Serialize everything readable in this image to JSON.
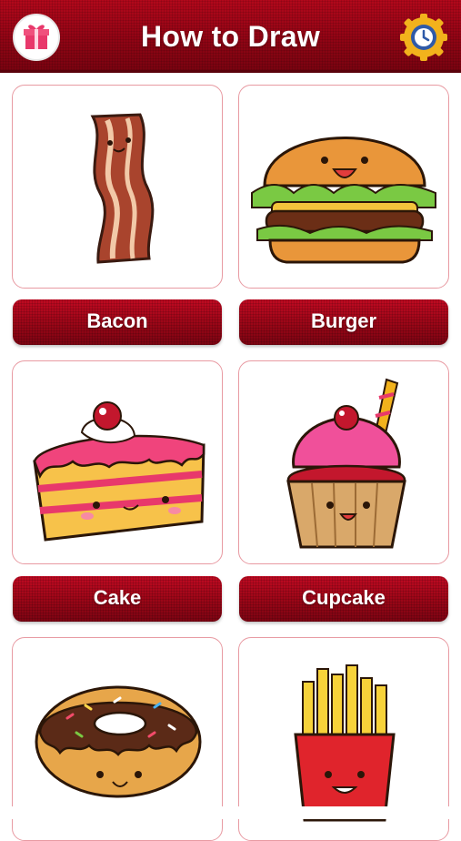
{
  "header": {
    "title": "How to Draw",
    "left_icon": "gift-icon",
    "right_icon": "settings-clock-icon"
  },
  "items": [
    {
      "label": "Bacon",
      "icon": "bacon-icon"
    },
    {
      "label": "Burger",
      "icon": "burger-icon"
    },
    {
      "label": "Cake",
      "icon": "cake-icon"
    },
    {
      "label": "Cupcake",
      "icon": "cupcake-icon"
    },
    {
      "icon": "donut-icon"
    },
    {
      "icon": "fries-icon"
    }
  ],
  "colors": {
    "primary_red": "#9a0617",
    "card_border": "#e89aa2",
    "settings_gold": "#f2b21c",
    "settings_blue": "#2f5aa8"
  }
}
